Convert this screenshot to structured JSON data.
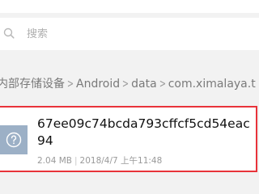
{
  "search": {
    "placeholder": "搜索"
  },
  "breadcrumb": [
    "内部存储设备",
    "Android",
    "data",
    "com.ximalaya.t"
  ],
  "file": {
    "name": "67ee09c74bcda793cffcf5cd54eac94",
    "size": "2.04 MB",
    "modified": "2018/4/7 上午11:48",
    "icon": "unknown-file-icon"
  },
  "colors": {
    "highlight": "#e8333a",
    "thumb": "#9cb0c6"
  }
}
